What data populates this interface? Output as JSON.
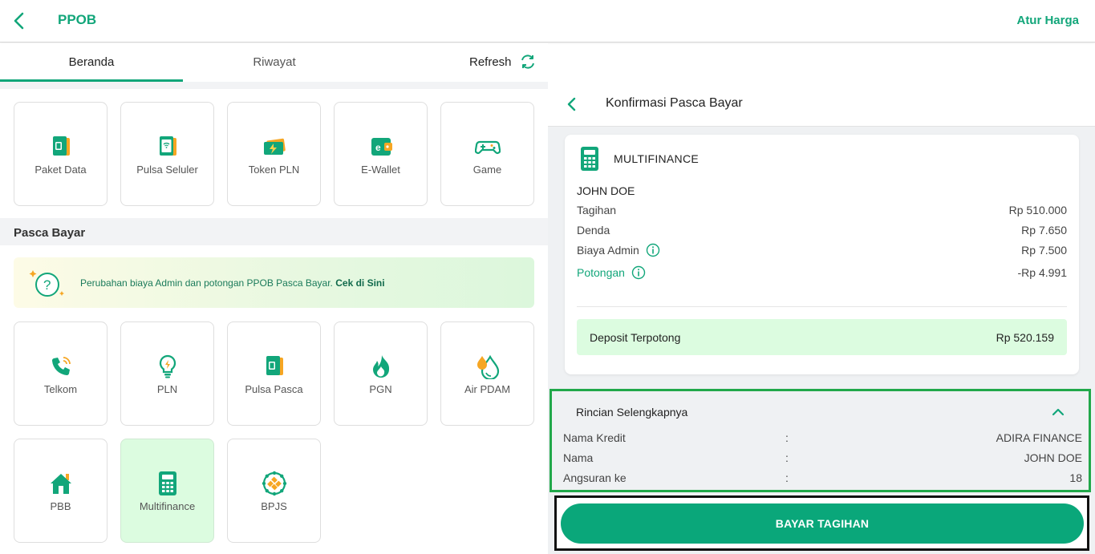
{
  "header": {
    "title": "PPOB",
    "action_label": "Atur Harga"
  },
  "tabs": [
    {
      "label": "Beranda",
      "active": true
    },
    {
      "label": "Riwayat",
      "active": false
    },
    {
      "label": "Refresh",
      "active": false
    }
  ],
  "prabayar": {
    "items": [
      {
        "label": "Paket Data",
        "icon": "sim-card-icon"
      },
      {
        "label": "Pulsa Seluler",
        "icon": "phone-signal-icon"
      },
      {
        "label": "Token PLN",
        "icon": "electricity-token-icon"
      },
      {
        "label": "E-Wallet",
        "icon": "wallet-icon"
      },
      {
        "label": "Game",
        "icon": "gamepad-icon"
      }
    ]
  },
  "pascabayar": {
    "title": "Pasca Bayar",
    "notice_text": "Perubahan biaya Admin dan potongan PPOB Pasca Bayar.",
    "notice_link": "Cek di Sini",
    "items": [
      {
        "label": "Telkom",
        "icon": "telephone-icon"
      },
      {
        "label": "PLN",
        "icon": "lightbulb-icon"
      },
      {
        "label": "Pulsa Pasca",
        "icon": "sim-card-icon"
      },
      {
        "label": "PGN",
        "icon": "gas-flame-icon"
      },
      {
        "label": "Air PDAM",
        "icon": "water-drop-icon"
      },
      {
        "label": "PBB",
        "icon": "house-icon"
      },
      {
        "label": "Multifinance",
        "icon": "calculator-icon",
        "selected": true
      },
      {
        "label": "BPJS",
        "icon": "bpjs-icon"
      }
    ]
  },
  "confirm": {
    "title": "Konfirmasi Pasca Bayar",
    "product": "MULTIFINANCE",
    "customer_name": "JOHN DOE",
    "rows": [
      {
        "label": "Tagihan",
        "value": "Rp 510.000"
      },
      {
        "label": "Denda",
        "value": "Rp 7.650"
      },
      {
        "label": "Biaya Admin",
        "value": "Rp 7.500"
      },
      {
        "label": "Potongan",
        "value": "-Rp 4.991"
      }
    ],
    "deposit_label": "Deposit Terpotong",
    "deposit_value": "Rp 520.159",
    "detail": {
      "title": "Rincian Selengkapnya",
      "rows": [
        {
          "label": "Nama Kredit",
          "sep": ":",
          "value": "ADIRA FINANCE"
        },
        {
          "label": "Nama",
          "sep": ":",
          "value": "JOHN DOE"
        },
        {
          "label": "Angsuran ke",
          "sep": ":",
          "value": "18"
        }
      ]
    },
    "pay_label": "BAYAR TAGIHAN"
  },
  "colors": {
    "brand": "#12a67a",
    "button": "#0aa77a",
    "selected_bg": "#dcfce0",
    "highlight_border": "#21a84a"
  }
}
